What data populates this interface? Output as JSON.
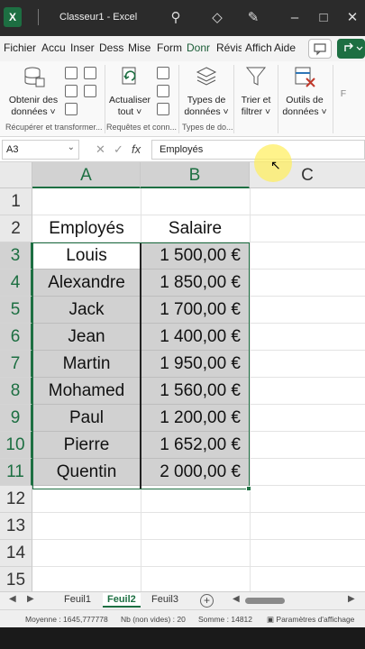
{
  "app": {
    "logo_letter": "X",
    "doc_title": "Classeur1 - Excel"
  },
  "title_icons": [
    "search-icon",
    "diamond-icon",
    "pen-icon",
    "minimize-icon",
    "maximize-icon",
    "close-icon"
  ],
  "ribbon_tabs": [
    {
      "label": "Fichier",
      "active": false
    },
    {
      "label": "Accu",
      "active": false
    },
    {
      "label": "Inser",
      "active": false
    },
    {
      "label": "Dessi",
      "active": false
    },
    {
      "label": "Mise",
      "active": false
    },
    {
      "label": "Form",
      "active": false
    },
    {
      "label": "Donr",
      "active": true
    },
    {
      "label": "Révis",
      "active": false
    },
    {
      "label": "Affich",
      "active": false
    },
    {
      "label": "Aide",
      "active": false
    }
  ],
  "ribbon": {
    "get_data": "Obtenir des données ˅",
    "refresh_all": "Actualiser tout ˅",
    "data_types": "Types de données ˅",
    "sort_filter": "Trier et filtrer ˅",
    "data_tools": "Outils de données ˅",
    "group_get": "Récupérer et transformer...",
    "group_queries": "Requêtes et conn...",
    "group_types": "Types de do...",
    "overflow": "F"
  },
  "formula_bar": {
    "name_box": "A3",
    "cancel_glyph": "✕",
    "enter_glyph": "✓",
    "fx_glyph": "fx",
    "content": "Employés"
  },
  "columns": [
    "A",
    "B",
    "C"
  ],
  "rows": [
    "1",
    "2",
    "3",
    "4",
    "5",
    "6",
    "7",
    "8",
    "9",
    "10",
    "11",
    "12",
    "13",
    "14",
    "15"
  ],
  "table": {
    "header_name": "Employés",
    "header_salary": "Salaire",
    "names": [
      "Louis",
      "Alexandre",
      "Jack",
      "Jean",
      "Martin",
      "Mohamed",
      "Paul",
      "Pierre",
      "Quentin"
    ],
    "salaries": [
      "1 500,00 €",
      "1 850,00 €",
      "1 700,00 €",
      "1 400,00 €",
      "1 950,00 €",
      "1 560,00 €",
      "1 200,00 €",
      "1 652,00 €",
      "2 000,00 €"
    ]
  },
  "sheets": [
    {
      "label": "Feuil1",
      "active": false
    },
    {
      "label": "Feuil2",
      "active": true
    },
    {
      "label": "Feuil3",
      "active": false
    }
  ],
  "status": {
    "average": "Moyenne : 1645,777778",
    "count": "Nb (non vides) : 20",
    "sum": "Somme : 14812",
    "display_settings": "Paramètres d'affichage"
  },
  "colors": {
    "excel_green": "#1d6f42",
    "selection_fill": "#d1d1d1"
  }
}
